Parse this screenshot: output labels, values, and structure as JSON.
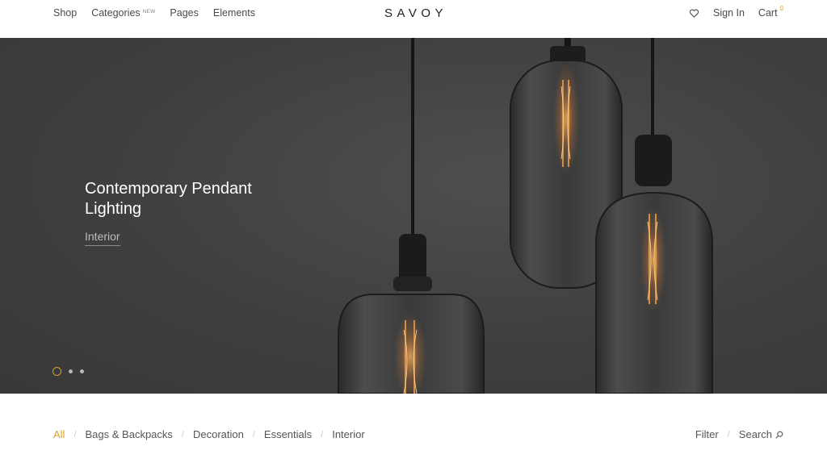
{
  "header": {
    "nav": [
      {
        "label": "Shop"
      },
      {
        "label": "Categories",
        "badge": "NEW"
      },
      {
        "label": "Pages"
      },
      {
        "label": "Elements"
      }
    ],
    "logo": "SAVOY",
    "sign_in": "Sign In",
    "cart_label": "Cart",
    "cart_count": "0",
    "wishlist_icon": "heart-icon"
  },
  "hero": {
    "title": "Contemporary Pendant Lighting",
    "subtitle": "Interior",
    "slides": 3,
    "active_slide": 1
  },
  "filters": {
    "categories": [
      {
        "label": "All",
        "active": true
      },
      {
        "label": "Bags & Backpacks"
      },
      {
        "label": "Decoration"
      },
      {
        "label": "Essentials"
      },
      {
        "label": "Interior"
      }
    ],
    "separator": "/",
    "filter_label": "Filter",
    "search_label": "Search",
    "search_icon": "search-icon"
  },
  "colors": {
    "accent": "#d8a227",
    "hero_bg": "#3f3f3f",
    "text": "#4a4a4a"
  }
}
